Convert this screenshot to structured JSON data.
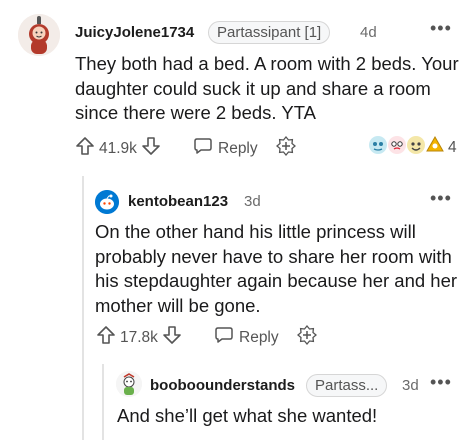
{
  "comments": [
    {
      "username": "JuicyJolene1734",
      "flair": "Partassipant [1]",
      "time": "4d",
      "text": "They both had a bed. A room with 2 beds. Your daughter could suck it up and share a room since there were 2 beds. YTA",
      "votes": "41.9k",
      "reply_label": "Reply",
      "award_count": "4"
    },
    {
      "username": "kentobean123",
      "time": "3d",
      "text": "On the other hand his little princess will probably never have to share her room with his stepdaughter again because her and her mother will be gone.",
      "votes": "17.8k",
      "reply_label": "Reply"
    },
    {
      "username": "booboounderstands",
      "flair": "Partass...",
      "time": "3d",
      "text": "And she’ll get what she wanted!"
    }
  ],
  "icons": {
    "more": "more-options-icon",
    "upvote": "upvote-arrow-icon",
    "downvote": "downvote-arrow-icon",
    "reply": "speech-bubble-icon",
    "award": "add-award-icon"
  },
  "colors": {
    "avatar1_bg": "#e6e6e6",
    "avatar2_bg": "#0079d3",
    "text_muted": "#6b6b6b"
  }
}
